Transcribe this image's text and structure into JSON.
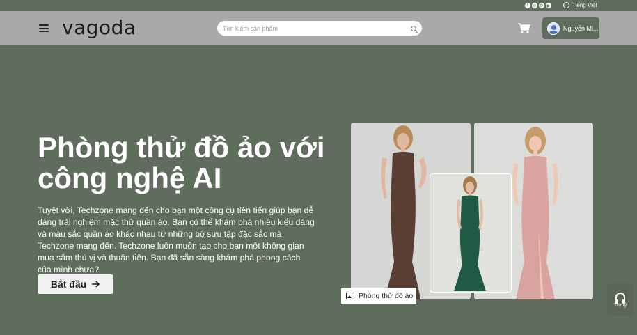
{
  "topbar": {
    "social_icons": [
      "facebook-icon",
      "instagram-icon",
      "pinterest-icon",
      "youtube-icon"
    ],
    "language": "Tiếng Việt"
  },
  "header": {
    "logo": "vagoda",
    "search_placeholder": "Tìm kiếm sản phẩm",
    "user_name": "Nguyễn Mi..."
  },
  "hero": {
    "title": "Phòng thử đồ ảo với công nghệ AI",
    "description": "Tuyệt vời, Techzone mang đến cho bạn một công cụ tiên tiến giúp bạn dễ dàng trải nghiệm mặc thử quần áo. Bạn có thể khám phá nhiều kiểu dáng và màu sắc quần áo khác nhau từ những bộ sưu tập đặc sắc mà Techzone mang đến. Techzone luôn muốn tạo cho bạn một không gian mua sắm thú vị và thuận tiện. Bạn đã sẵn sàng khám phá phong cách của mình chưa?",
    "start_button": "Bắt đầu",
    "badge_label": "Phòng thử đồ ảo"
  },
  "assistant": {
    "label": "Trợ lý"
  },
  "colors": {
    "background": "#5f6e5c",
    "header": "#a9a9a9",
    "dress_brown": "#5a3e34",
    "dress_green": "#1f5a45",
    "dress_pink": "#d9a3a0"
  }
}
